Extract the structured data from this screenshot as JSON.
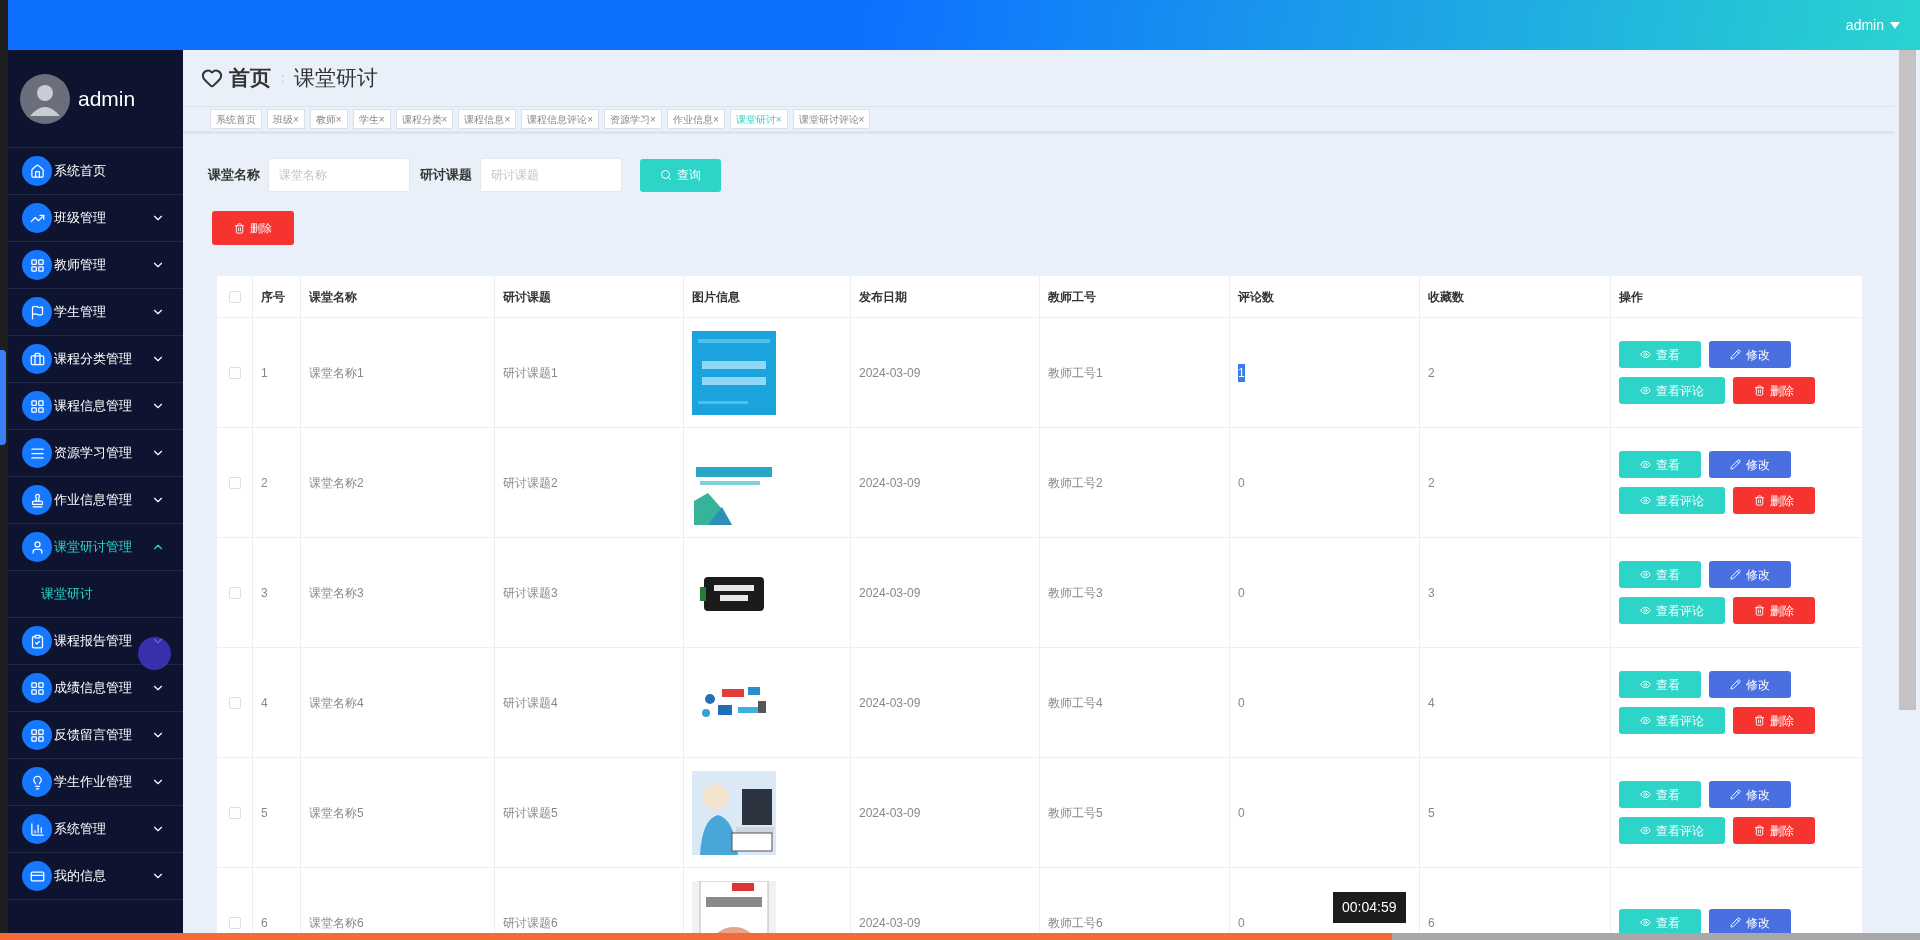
{
  "header": {
    "user": "admin"
  },
  "sidebar": {
    "user": "admin",
    "items": [
      {
        "label": "系统首页",
        "kind": "link"
      },
      {
        "label": "班级管理",
        "kind": "group",
        "expanded": false
      },
      {
        "label": "教师管理",
        "kind": "group",
        "expanded": false
      },
      {
        "label": "学生管理",
        "kind": "group",
        "expanded": false
      },
      {
        "label": "课程分类管理",
        "kind": "group",
        "expanded": false
      },
      {
        "label": "课程信息管理",
        "kind": "group",
        "expanded": false
      },
      {
        "label": "资源学习管理",
        "kind": "group",
        "expanded": false
      },
      {
        "label": "作业信息管理",
        "kind": "group",
        "expanded": false
      },
      {
        "label": "课堂研讨管理",
        "kind": "group",
        "expanded": true,
        "children": [
          {
            "label": "课堂研讨",
            "selected": true
          }
        ]
      },
      {
        "label": "课程报告管理",
        "kind": "group",
        "expanded": false
      },
      {
        "label": "成绩信息管理",
        "kind": "group",
        "expanded": false
      },
      {
        "label": "反馈留言管理",
        "kind": "group",
        "expanded": false
      },
      {
        "label": "学生作业管理",
        "kind": "group",
        "expanded": false
      },
      {
        "label": "系统管理",
        "kind": "group",
        "expanded": false
      },
      {
        "label": "我的信息",
        "kind": "group",
        "expanded": false
      }
    ]
  },
  "breadcrumb": {
    "home": "首页",
    "separator": ":",
    "current": "课堂研讨"
  },
  "tabs": [
    {
      "label": "系统首页",
      "selected": false
    },
    {
      "label": "班级",
      "close": "×",
      "selected": false
    },
    {
      "label": "教师",
      "close": "×",
      "selected": false
    },
    {
      "label": "学生",
      "close": "×",
      "selected": false
    },
    {
      "label": "课程分类",
      "close": "×",
      "selected": false
    },
    {
      "label": "课程信息",
      "close": "×",
      "selected": false
    },
    {
      "label": "课程信息评论",
      "close": "×",
      "selected": false
    },
    {
      "label": "资源学习",
      "close": "×",
      "selected": false
    },
    {
      "label": "作业信息",
      "close": "×",
      "selected": false
    },
    {
      "label": "课堂研讨",
      "close": "×",
      "selected": true
    },
    {
      "label": "课堂研讨评论",
      "close": "×",
      "selected": false
    }
  ],
  "search": {
    "fields": [
      {
        "label": "课堂名称",
        "placeholder": "课堂名称"
      },
      {
        "label": "研讨课题",
        "placeholder": "研讨课题"
      }
    ],
    "button": "查询"
  },
  "delete_button": "删除",
  "table": {
    "all_checked": false,
    "columns": [
      "序号",
      "课堂名称",
      "研讨课题",
      "图片信息",
      "发布日期",
      "教师工号",
      "评论数",
      "收藏数",
      "操作"
    ],
    "rows": [
      {
        "checked": false,
        "cells": [
          "1",
          "课堂名称1",
          "研讨课题1",
          {
            "kind": "picture"
          },
          "2024-03-09",
          "教师工号1",
          "1",
          "2"
        ],
        "comment_highlighted": true,
        "actions": [
          {
            "label": "查看",
            "kind": "view"
          },
          {
            "label": "修改",
            "kind": "edit"
          },
          {
            "label": "查看评论",
            "kind": "comments"
          },
          {
            "label": "删除",
            "kind": "delete"
          }
        ]
      },
      {
        "checked": false,
        "cells": [
          "2",
          "课堂名称2",
          "研讨课题2",
          {
            "kind": "picture"
          },
          "2024-03-09",
          "教师工号2",
          "0",
          "2"
        ],
        "comment_highlighted": false,
        "actions": [
          {
            "label": "查看",
            "kind": "view"
          },
          {
            "label": "修改",
            "kind": "edit"
          },
          {
            "label": "查看评论",
            "kind": "comments"
          },
          {
            "label": "删除",
            "kind": "delete"
          }
        ]
      },
      {
        "checked": false,
        "cells": [
          "3",
          "课堂名称3",
          "研讨课题3",
          {
            "kind": "picture"
          },
          "2024-03-09",
          "教师工号3",
          "0",
          "3"
        ],
        "comment_highlighted": false,
        "actions": [
          {
            "label": "查看",
            "kind": "view"
          },
          {
            "label": "修改",
            "kind": "edit"
          },
          {
            "label": "查看评论",
            "kind": "comments"
          },
          {
            "label": "删除",
            "kind": "delete"
          }
        ]
      },
      {
        "checked": false,
        "cells": [
          "4",
          "课堂名称4",
          "研讨课题4",
          {
            "kind": "picture"
          },
          "2024-03-09",
          "教师工号4",
          "0",
          "4"
        ],
        "comment_highlighted": false,
        "actions": [
          {
            "label": "查看",
            "kind": "view"
          },
          {
            "label": "修改",
            "kind": "edit"
          },
          {
            "label": "查看评论",
            "kind": "comments"
          },
          {
            "label": "删除",
            "kind": "delete"
          }
        ]
      },
      {
        "checked": false,
        "cells": [
          "5",
          "课堂名称5",
          "研讨课题5",
          {
            "kind": "picture"
          },
          "2024-03-09",
          "教师工号5",
          "0",
          "5"
        ],
        "comment_highlighted": false,
        "actions": [
          {
            "label": "查看",
            "kind": "view"
          },
          {
            "label": "修改",
            "kind": "edit"
          },
          {
            "label": "查看评论",
            "kind": "comments"
          },
          {
            "label": "删除",
            "kind": "delete"
          }
        ]
      },
      {
        "checked": false,
        "cells": [
          "6",
          "课堂名称6",
          "研讨课题6",
          {
            "kind": "picture"
          },
          "2024-03-09",
          "教师工号6",
          "0",
          "6"
        ],
        "comment_highlighted": false,
        "actions": [
          {
            "label": "查看",
            "kind": "view"
          },
          {
            "label": "修改",
            "kind": "edit"
          }
        ]
      }
    ]
  },
  "video": {
    "time": "00:04:59",
    "level": 0.725
  }
}
